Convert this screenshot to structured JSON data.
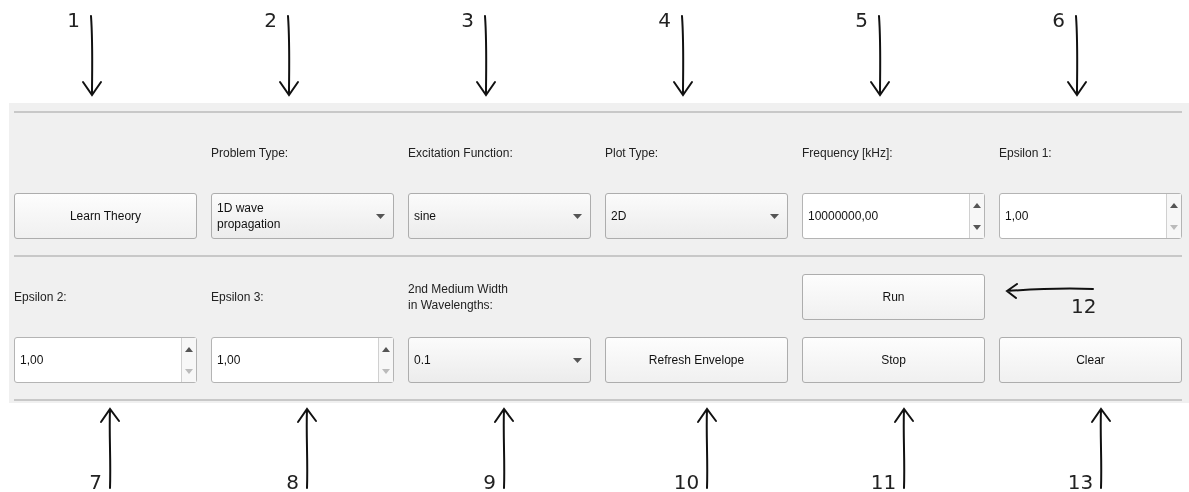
{
  "annotations_top": [
    {
      "text": "1"
    },
    {
      "text": "2"
    },
    {
      "text": "3"
    },
    {
      "text": "4"
    },
    {
      "text": "5"
    },
    {
      "text": "6"
    }
  ],
  "panel": {
    "rows": [
      {
        "cells": [
          {
            "header": {
              "kind": "none"
            },
            "control": {
              "kind": "button",
              "text": "Learn Theory"
            }
          },
          {
            "header": {
              "kind": "label",
              "text": "Problem Type:"
            },
            "control": {
              "kind": "dropdown",
              "value": "1D wave\npropagation"
            }
          },
          {
            "header": {
              "kind": "label",
              "text": "Excitation Function:"
            },
            "control": {
              "kind": "dropdown",
              "value": "sine"
            }
          },
          {
            "header": {
              "kind": "label",
              "text": "Plot Type:"
            },
            "control": {
              "kind": "dropdown",
              "value": "2D"
            }
          },
          {
            "header": {
              "kind": "label",
              "text": "Frequency [kHz]:"
            },
            "control": {
              "kind": "spinner",
              "value": "10000000,00",
              "down_disabled": false
            }
          },
          {
            "header": {
              "kind": "label",
              "text": "Epsilon 1:"
            },
            "control": {
              "kind": "spinner",
              "value": "1,00",
              "down_disabled": true
            }
          }
        ]
      },
      {
        "cells": [
          {
            "header": {
              "kind": "label",
              "text": "Epsilon 2:"
            },
            "control": {
              "kind": "spinner",
              "value": "1,00",
              "down_disabled": true
            }
          },
          {
            "header": {
              "kind": "label",
              "text": "Epsilon 3:"
            },
            "control": {
              "kind": "spinner",
              "value": "1,00",
              "down_disabled": true
            }
          },
          {
            "header": {
              "kind": "label",
              "text": "2nd Medium Width\nin Wavelengths:"
            },
            "control": {
              "kind": "dropdown",
              "value": "0.1"
            }
          },
          {
            "header": {
              "kind": "none"
            },
            "control": {
              "kind": "button",
              "text": "Refresh Envelope"
            }
          },
          {
            "header": {
              "kind": "button",
              "text": "Run"
            },
            "control": {
              "kind": "button",
              "text": "Stop"
            }
          },
          {
            "header": {
              "kind": "annotation",
              "text": "12"
            },
            "control": {
              "kind": "button",
              "text": "Clear"
            }
          }
        ]
      }
    ]
  },
  "annotations_bottom": [
    {
      "text": "7"
    },
    {
      "text": "8"
    },
    {
      "text": "9"
    },
    {
      "text": "10"
    },
    {
      "text": "11"
    },
    {
      "text": "13"
    }
  ]
}
